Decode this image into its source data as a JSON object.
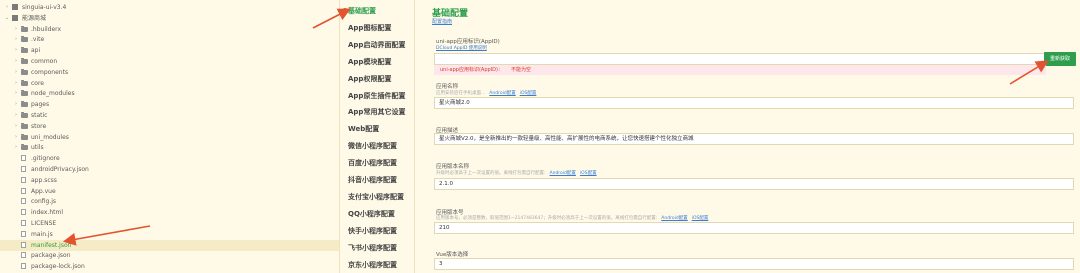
{
  "tree": {
    "rows": [
      {
        "label": "singuia-ui-v3.4",
        "type": "proj",
        "arrow": "›",
        "indent": 0
      },
      {
        "label": "能源商城",
        "type": "proj",
        "arrow": "⌄",
        "indent": 0
      },
      {
        "label": ".hbuilderx",
        "type": "folder",
        "arrow": "›",
        "indent": 1
      },
      {
        "label": ".vite",
        "type": "folder",
        "arrow": "›",
        "indent": 1
      },
      {
        "label": "api",
        "type": "folder",
        "arrow": "›",
        "indent": 1
      },
      {
        "label": "common",
        "type": "folder",
        "arrow": "›",
        "indent": 1
      },
      {
        "label": "components",
        "type": "folder",
        "arrow": "›",
        "indent": 1
      },
      {
        "label": "core",
        "type": "folder",
        "arrow": "›",
        "indent": 1
      },
      {
        "label": "node_modules",
        "type": "folder",
        "arrow": "›",
        "indent": 1
      },
      {
        "label": "pages",
        "type": "folder",
        "arrow": "›",
        "indent": 1
      },
      {
        "label": "static",
        "type": "folder",
        "arrow": "›",
        "indent": 1
      },
      {
        "label": "store",
        "type": "folder",
        "arrow": "›",
        "indent": 1
      },
      {
        "label": "uni_modules",
        "type": "folder",
        "arrow": "›",
        "indent": 1
      },
      {
        "label": "utils",
        "type": "folder",
        "arrow": "›",
        "indent": 1
      },
      {
        "label": ".gitignore",
        "type": "file",
        "arrow": "",
        "indent": 1
      },
      {
        "label": "androidPrivacy.json",
        "type": "file",
        "arrow": "",
        "indent": 1
      },
      {
        "label": "app.scss",
        "type": "file",
        "arrow": "",
        "indent": 1
      },
      {
        "label": "App.vue",
        "type": "file",
        "arrow": "",
        "indent": 1
      },
      {
        "label": "config.js",
        "type": "file",
        "arrow": "",
        "indent": 1
      },
      {
        "label": "index.html",
        "type": "file",
        "arrow": "",
        "indent": 1
      },
      {
        "label": "LICENSE",
        "type": "file",
        "arrow": "",
        "indent": 1
      },
      {
        "label": "main.js",
        "type": "file",
        "arrow": "",
        "indent": 1
      },
      {
        "label": "manifest.json",
        "type": "file",
        "arrow": "",
        "indent": 1,
        "selected": true
      },
      {
        "label": "package.json",
        "type": "file",
        "arrow": "",
        "indent": 1
      },
      {
        "label": "package-lock.json",
        "type": "file",
        "arrow": "",
        "indent": 1
      }
    ]
  },
  "nav": {
    "badge": "!",
    "items": [
      {
        "label": "基础配置",
        "active": true
      },
      {
        "label": "App图标配置"
      },
      {
        "label": "App启动界面配置"
      },
      {
        "label": "App模块配置"
      },
      {
        "label": "App权限配置"
      },
      {
        "label": "App原生插件配置"
      },
      {
        "label": "App常用其它设置"
      },
      {
        "label": "Web配置"
      },
      {
        "label": "微信小程序配置"
      },
      {
        "label": "百度小程序配置"
      },
      {
        "label": "抖音小程序配置"
      },
      {
        "label": "支付宝小程序配置"
      },
      {
        "label": "QQ小程序配置"
      },
      {
        "label": "快手小程序配置"
      },
      {
        "label": "飞书小程序配置"
      },
      {
        "label": "京东小程序配置"
      }
    ]
  },
  "main": {
    "title": "基础配置",
    "guide_link": "配置指南",
    "appid": {
      "label": "uni-app应用标识(AppID)",
      "link": "DCloud AppID 使用说明",
      "value": "",
      "fetch_button": "重新获取",
      "error_label": "uni-app应用标识(AppID)：",
      "error_value": "不能为空"
    },
    "name": {
      "label": "应用名称",
      "hint": "应用安装后在手机桌面...",
      "android_link": "Android配置",
      "ios_link": "iOS配置",
      "value": "星火商城2.0"
    },
    "desc": {
      "label": "应用描述",
      "value": "星火商城V2.0，是全新推出的一款轻量级、高性能、高扩展性的电商系统，让您快速搭建个性化独立商城"
    },
    "version_name": {
      "label": "应用版本名称",
      "hint": "升级时必须高于上一次设置的值。离线打包需自行配置:",
      "android_link": "Android配置",
      "ios_link": "iOS配置",
      "value": "2.1.0"
    },
    "version_code": {
      "label": "应用版本号",
      "hint": "应用版本号，必须是整数，取值范围1~2147483647；升级时必须高于上一次设置的值。离线打包需自行配置:",
      "android_link": "Android配置",
      "ios_link": "iOS配置",
      "value": "210"
    },
    "vue": {
      "label": "Vue版本选择",
      "value": "3"
    }
  },
  "colors": {
    "accent": "#2e9e4d",
    "arrow": "#e4532f",
    "error": "#dd3333"
  }
}
